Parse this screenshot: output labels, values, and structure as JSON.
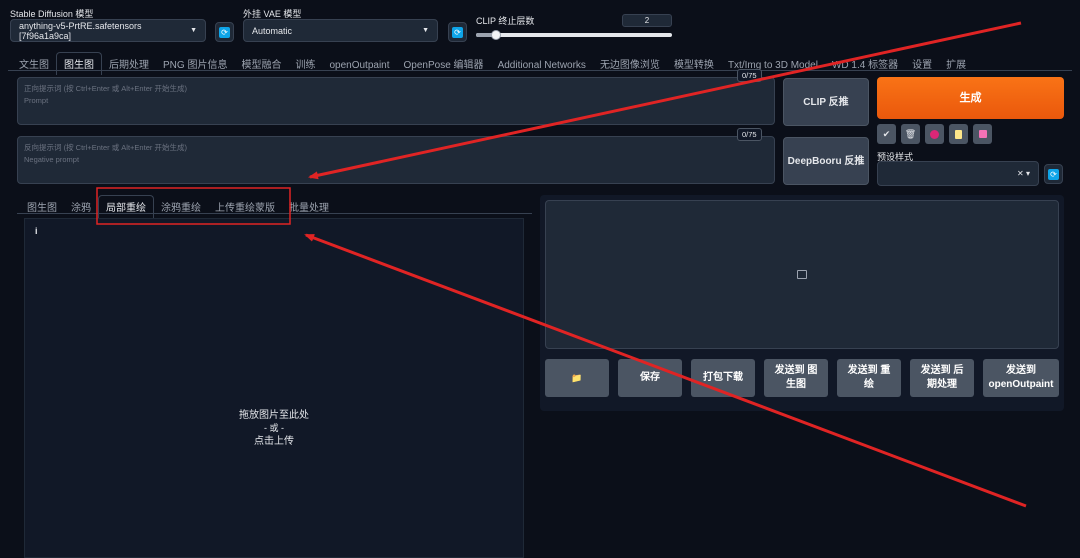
{
  "top": {
    "sd_model": {
      "label": "Stable Diffusion 模型",
      "value": "anything-v5-PrtRE.safetensors [7f96a1a9ca]"
    },
    "vae": {
      "label": "外挂 VAE 模型",
      "value": "Automatic"
    },
    "clip": {
      "label": "CLIP 终止层数",
      "value": "2",
      "fraction": 0.1
    }
  },
  "main_tabs": [
    "文生图",
    "图生图",
    "后期处理",
    "PNG 图片信息",
    "模型融合",
    "训练",
    "openOutpaint",
    "OpenPose 编辑器",
    "Additional Networks",
    "无边图像浏览",
    "模型转换",
    "Txt/Img to 3D Model",
    "WD 1.4 标签器",
    "设置",
    "扩展"
  ],
  "prompt": {
    "counter": "0/75",
    "placeholder_line1": "正向提示词 (按 Ctrl+Enter 或 Alt+Enter 开始生成)",
    "placeholder_line2": "Prompt"
  },
  "negative": {
    "counter": "0/75",
    "placeholder_line1": "反向提示词 (按 Ctrl+Enter 或 Alt+Enter 开始生成)",
    "placeholder_line2": "Negative prompt"
  },
  "buttons": {
    "clip": "CLIP 反推",
    "deepbooru": "DeepBooru 反推",
    "generate": "生成"
  },
  "style": {
    "label": "预设样式"
  },
  "tool_icons": [
    "check-icon",
    "trash-icon",
    "image-icon",
    "clipboard-icon",
    "save-icon"
  ],
  "sub_tabs": [
    "图生图",
    "涂鸦",
    "局部重绘",
    "涂鸦重绘",
    "上传重绘蒙版",
    "批量处理"
  ],
  "upload": {
    "info": "i",
    "line1": "拖放图片至此处",
    "line2": "- 或 -",
    "line3": "点击上传"
  },
  "output_buttons": {
    "folder": "📁",
    "save": "保存",
    "zip": "打包下载",
    "send_img2img": "发送到 图生图",
    "send_inpaint": "发送到 重绘",
    "send_extras": "发送到 后期处理",
    "send_outpaint": "发送到 openOutpaint"
  },
  "colors": {
    "accent": "#f97316",
    "annotation": "#e02424"
  }
}
